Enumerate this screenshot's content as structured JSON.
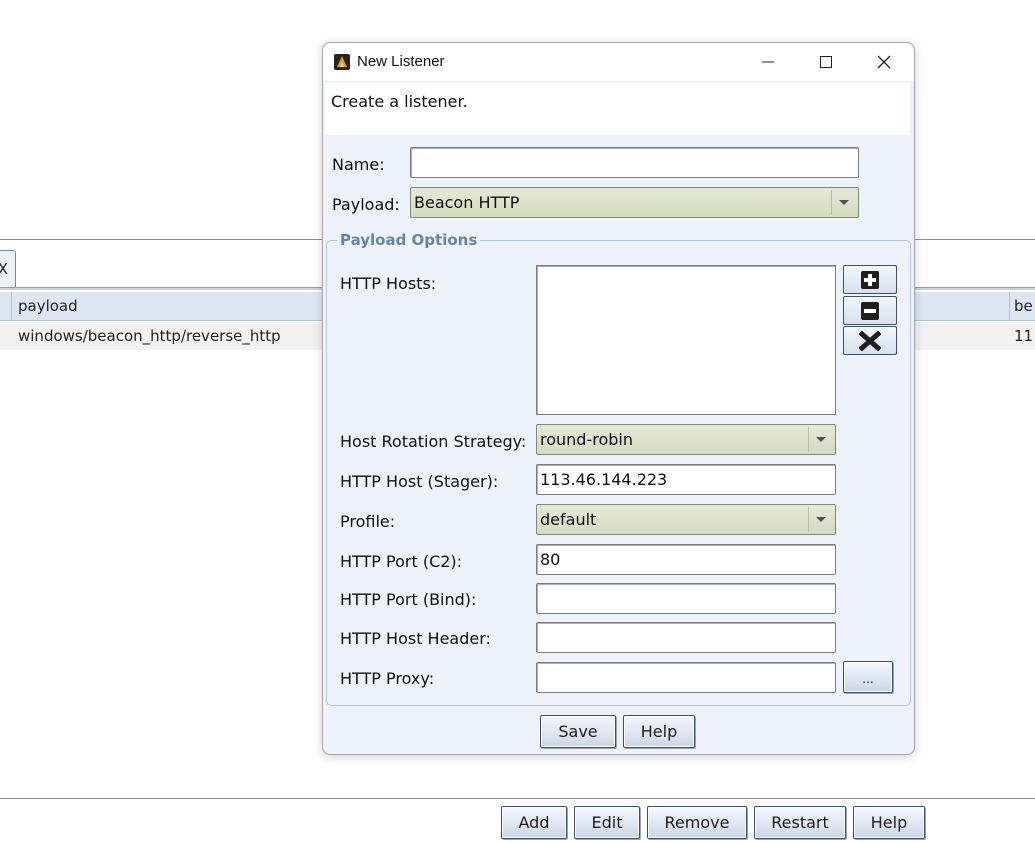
{
  "background": {
    "tab_label": "X",
    "table": {
      "columns": [
        "payload",
        "beacons"
      ],
      "columns_visible": [
        "payload",
        "be"
      ],
      "rows": [
        {
          "payload": "windows/beacon_http/reverse_http",
          "beacons_visible": "11"
        }
      ]
    },
    "buttons": {
      "add": "Add",
      "edit": "Edit",
      "remove": "Remove",
      "restart": "Restart",
      "help": "Help"
    }
  },
  "dialog": {
    "title": "New Listener",
    "app_icon": "cobalt-strike-app-icon",
    "description": "Create a listener.",
    "name_label": "Name:",
    "name_value": "",
    "payload_label": "Payload:",
    "payload_value": "Beacon HTTP",
    "group_title": "Payload Options",
    "options": {
      "http_hosts_label": "HTTP Hosts:",
      "http_hosts": [],
      "host_rotation_label": "Host Rotation Strategy:",
      "host_rotation_value": "round-robin",
      "stager_host_label": "HTTP Host (Stager):",
      "stager_host_value": "113.46.144.223",
      "profile_label": "Profile:",
      "profile_value": "default",
      "port_c2_label": "HTTP Port (C2):",
      "port_c2_value": "80",
      "port_bind_label": "HTTP Port (Bind):",
      "port_bind_value": "",
      "host_header_label": "HTTP Host Header:",
      "host_header_value": "",
      "proxy_label": "HTTP Proxy:",
      "proxy_value": "",
      "proxy_button": "..."
    },
    "save_button": "Save",
    "help_button": "Help"
  },
  "colors": {
    "dialog_bg": "#eef2fa",
    "combo_bg": "#d5dbbf",
    "group_title": "#6883a8",
    "table_header": "#dde6f3"
  }
}
